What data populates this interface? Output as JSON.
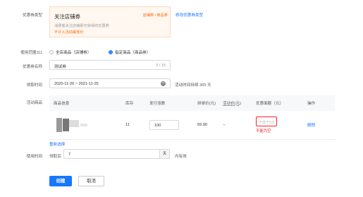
{
  "coupon_type": {
    "label": "优惠券类型",
    "card_title": "关注店铺券",
    "card_desc": "消费者关注店铺即可获得的优惠券",
    "card_note": "不计入活动最低价",
    "tag": "店铺券 / 商品券",
    "change_link": "修改优惠券类型"
  },
  "scope": {
    "label": "使用范围111",
    "option_all": "全店商品（店铺券）",
    "option_specific": "指定商品（商品券）",
    "selected": "option_specific"
  },
  "coupon_name": {
    "label": "优惠券名称",
    "value": "测试券",
    "count": "3 / 15"
  },
  "claim_time": {
    "label": "领取时间",
    "value": "2020-11-26 ~ 2021-11-25",
    "duration": "活动时间持续 365 天"
  },
  "products": {
    "label": "活动商品",
    "columns": [
      "商品信息",
      "库存",
      "发行张数",
      "拼单价(元)",
      "活动价(元)",
      "优惠面额（元）",
      "操作"
    ],
    "row": {
      "stock": "11",
      "issue_count": "100",
      "group_price": "69.90",
      "activity_price": "--",
      "discount_placeholder": "不低于5元",
      "discount_error": "不能为空",
      "action": "删除"
    },
    "reselect": "重新选择"
  },
  "use_time": {
    "label": "使用时间",
    "prefix": "领取后",
    "value": "7",
    "unit": "天",
    "suffix": "内有效"
  },
  "buttons": {
    "create": "创建",
    "cancel": "取消"
  },
  "colors": {
    "accent": "#1677ff",
    "warning": "#ff6a00",
    "error": "#f5222d",
    "card_bg": "#fff7f0"
  }
}
